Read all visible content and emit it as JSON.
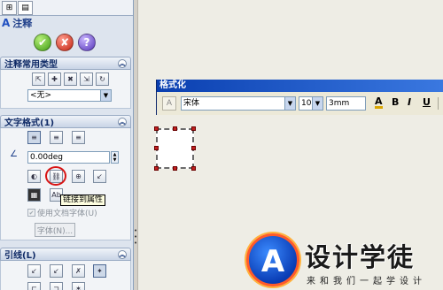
{
  "panel": {
    "title": "注释",
    "actions": {
      "ok": "✔",
      "cancel": "✘",
      "help": "?"
    },
    "sections": {
      "common_types": {
        "title": "注释常用类型",
        "style_select": "<无>"
      },
      "text_format": {
        "title": "文字格式(1)",
        "angle_value": "0.00deg",
        "tooltip": "链接到属性",
        "use_doc_font_label": "使用文档字体(U)",
        "font_button": "字体(N)..."
      },
      "leader": {
        "title": "引线(L)"
      }
    }
  },
  "format_toolbar": {
    "title": "格式化",
    "font_name": "宋体",
    "font_size": "10",
    "height_value": "3mm",
    "buttons": {
      "color": "A",
      "bold": "B",
      "italic": "I",
      "underline": "U"
    }
  },
  "watermark": {
    "logo_letter": "A",
    "title": "设计学徒",
    "subtitle": "来和我们一起学设计"
  },
  "colors": {
    "accent": "#0a3fb0",
    "highlight_circle": "#d81414",
    "handles": "#c02020"
  }
}
